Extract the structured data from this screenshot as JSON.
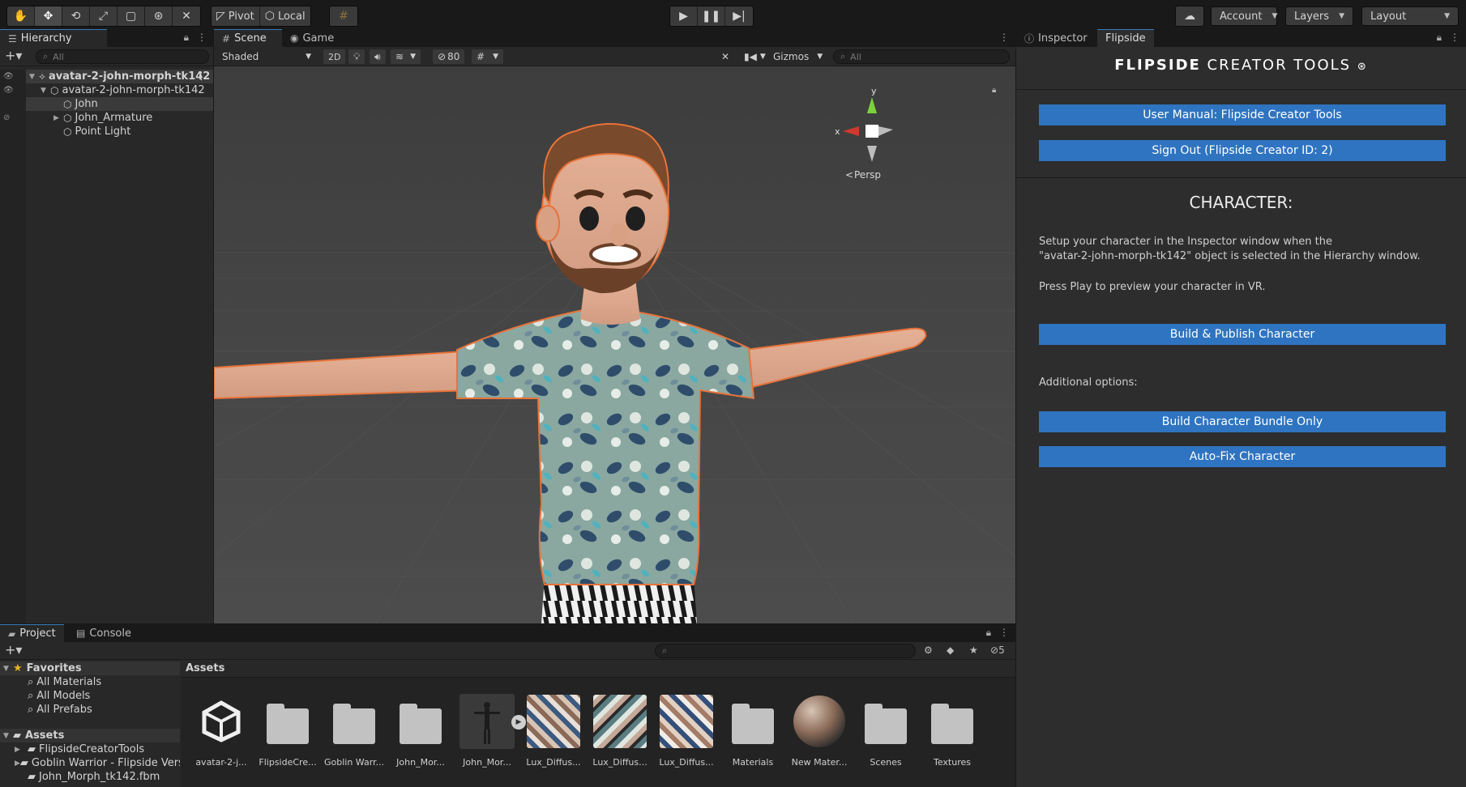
{
  "toolbar": {
    "tools": [
      "hand-tool-icon",
      "move-tool-icon",
      "rotate-tool-icon",
      "scale-tool-icon",
      "rect-tool-icon",
      "transform-tool-icon",
      "custom-tool-icon"
    ],
    "pivot_label": "Pivot",
    "local_label": "Local",
    "account_label": "Account",
    "layers_label": "Layers",
    "layout_label": "Layout"
  },
  "hierarchy": {
    "tab_label": "Hierarchy",
    "search_placeholder": "All",
    "items": [
      {
        "label": "avatar-2-john-morph-tk142"
      },
      {
        "label": "avatar-2-john-morph-tk142"
      },
      {
        "label": "John"
      },
      {
        "label": "John_Armature"
      },
      {
        "label": "Point Light"
      }
    ]
  },
  "scene": {
    "tabs": [
      {
        "label": "Scene"
      },
      {
        "label": "Game"
      }
    ],
    "shading_mode": "Shaded",
    "mode_2d": "2D",
    "hidden_count": "80",
    "gizmos_label": "Gizmos",
    "search_placeholder": "All",
    "persp_label": "Persp",
    "axis_y": "y",
    "axis_x": "x"
  },
  "inspector": {
    "tabs": [
      {
        "label": "Inspector"
      },
      {
        "label": "Flipside"
      }
    ]
  },
  "flipside": {
    "title_bold": "FLIPSIDE",
    "title_rest": "CREATOR TOOLS",
    "user_manual_button": "User Manual: Flipside Creator Tools",
    "sign_out_button": "Sign Out (Flipside Creator ID: 2)",
    "section_title": "CHARACTER:",
    "setup_text_1": "Setup your character in the Inspector window when the",
    "setup_text_2": "\"avatar-2-john-morph-tk142\" object is selected in the Hierarchy window.",
    "press_play_text": "Press Play to preview your character in VR.",
    "build_publish_button": "Build & Publish Character",
    "additional_options": "Additional options:",
    "build_bundle_button": "Build Character Bundle Only",
    "auto_fix_button": "Auto-Fix Character"
  },
  "project": {
    "tabs": [
      {
        "label": "Project"
      },
      {
        "label": "Console"
      }
    ],
    "hidden_count": "5",
    "favorites_label": "Favorites",
    "favorites": [
      {
        "label": "All Materials"
      },
      {
        "label": "All Models"
      },
      {
        "label": "All Prefabs"
      }
    ],
    "assets_root": "Assets",
    "asset_folders": [
      {
        "label": "FlipsideCreatorTools"
      },
      {
        "label": "Goblin Warrior - Flipside Vers"
      },
      {
        "label": "John_Morph_tk142.fbm"
      }
    ],
    "breadcrumb": "Assets",
    "assets": [
      {
        "label": "avatar-2-j...",
        "kind": "unity"
      },
      {
        "label": "FlipsideCre...",
        "kind": "folder"
      },
      {
        "label": "Goblin Warr...",
        "kind": "folder"
      },
      {
        "label": "John_Mor...",
        "kind": "folder"
      },
      {
        "label": "John_Mor...",
        "kind": "model"
      },
      {
        "label": "Lux_Diffus...",
        "kind": "texture"
      },
      {
        "label": "Lux_Diffus...",
        "kind": "texture"
      },
      {
        "label": "Lux_Diffus...",
        "kind": "texture"
      },
      {
        "label": "Materials",
        "kind": "folder"
      },
      {
        "label": "New Mater...",
        "kind": "material"
      },
      {
        "label": "Scenes",
        "kind": "folder"
      },
      {
        "label": "Textures",
        "kind": "folder"
      }
    ]
  },
  "colors": {
    "accent_blue": "#2f74c0",
    "selection_outline": "#e8733a",
    "panel_bg": "#282828",
    "shirt": "#8aa8a0"
  }
}
